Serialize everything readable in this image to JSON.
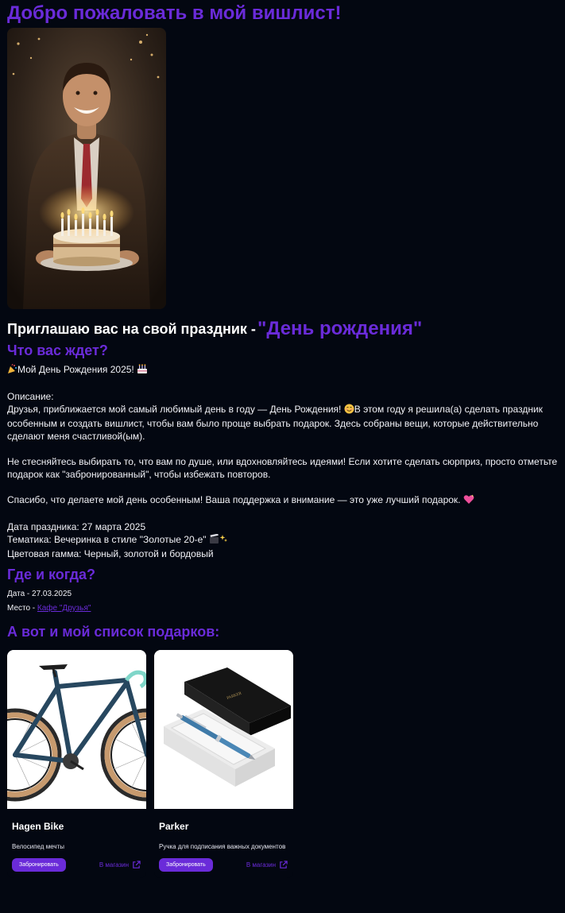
{
  "page": {
    "title": "Добро пожаловать в мой вишлист!"
  },
  "invite": {
    "text": "Приглашаю вас на свой праздник -",
    "event": "\"День рождения\""
  },
  "what": {
    "heading": "Что вас ждет?",
    "headline_icon_left": "party-popper-icon",
    "headline": "Мой День Рождения 2025!",
    "headline_icon_right": "birthday-cake-icon",
    "desc_label": "Описание:",
    "para1_before_icon": "Друзья, приближается мой самый любимый день в году — День Рождения!",
    "para1_icon": "smiling-face-icon",
    "para1_after_icon": "В этом году я решила(а) сделать праздник особенным и создать вишлист, чтобы вам было проще выбрать подарок. Здесь собраны вещи, которые действительно сделают меня счастливой(ым).",
    "para2": "Не стесняйтесь выбирать то, что вам по душе, или вдохновляйтесь идеями! Если хотите сделать сюрприз, просто отметьте подарок как \"забронированный\", чтобы избежать повторов.",
    "para3": "Спасибо, что делаете мой день особенным! Ваша поддержка и внимание — это уже лучший подарок.",
    "para3_icon": "sparkling-heart-icon",
    "date_line": "Дата праздника: 27 марта 2025",
    "theme_line": "Тематика: Вечеринка в стиле \"Золотые 20-е\"",
    "theme_icon": "movie-sparkles-icon",
    "colors_line": "Цветовая гамма: Черный, золотой и бордовый"
  },
  "where": {
    "heading": "Где и когда?",
    "date_label": "Дата - ",
    "date_value": "27.03.2025",
    "place_label": "Место - ",
    "place_link": "Кафе \"Друзья\""
  },
  "gifts": {
    "heading": "А вот и мой список подарков:",
    "items": [
      {
        "name": "Hagen Bike",
        "desc": "Велосипед мечты",
        "reserve_label": "Забронировать",
        "shop_label": "В магазин",
        "image_icon": "bicycle-photo"
      },
      {
        "name": "Parker",
        "desc": "Ручка для подписания важных документов",
        "reserve_label": "Забронировать",
        "shop_label": "В магазин",
        "image_icon": "pen-gift-box-photo"
      }
    ]
  },
  "colors": {
    "background": "#030711",
    "accent": "#6a2bd9",
    "text": "#f2f2f7"
  }
}
